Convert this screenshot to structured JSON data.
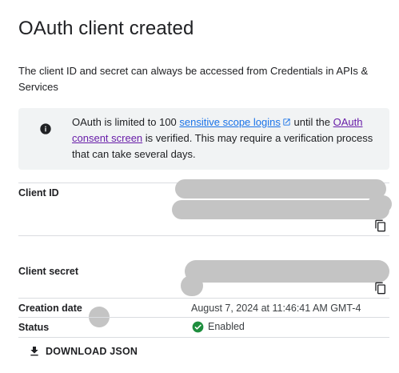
{
  "dialog": {
    "title": "OAuth client created",
    "description": "The client ID and secret can always be accessed from Credentials in APIs & Services"
  },
  "notice": {
    "icon": "info-icon",
    "text_before": "OAuth is limited to 100 ",
    "link1": "sensitive scope logins",
    "text_middle": " until the ",
    "link2": "OAuth consent screen",
    "text_after": " is verified. This may require a verification process that can take several days."
  },
  "fields": {
    "client_id_label": "Client ID",
    "client_secret_label": "Client secret",
    "creation_date_label": "Creation date",
    "creation_date_value": "August 7, 2024 at 11:46:41 AM GMT-4",
    "status_label": "Status",
    "status_value": "Enabled"
  },
  "actions": {
    "download_label": "DOWNLOAD JSON"
  },
  "colors": {
    "link": "#1a73e8",
    "visited_link": "#681da8",
    "success": "#1e8e3e",
    "notice_bg": "#f1f3f4"
  }
}
